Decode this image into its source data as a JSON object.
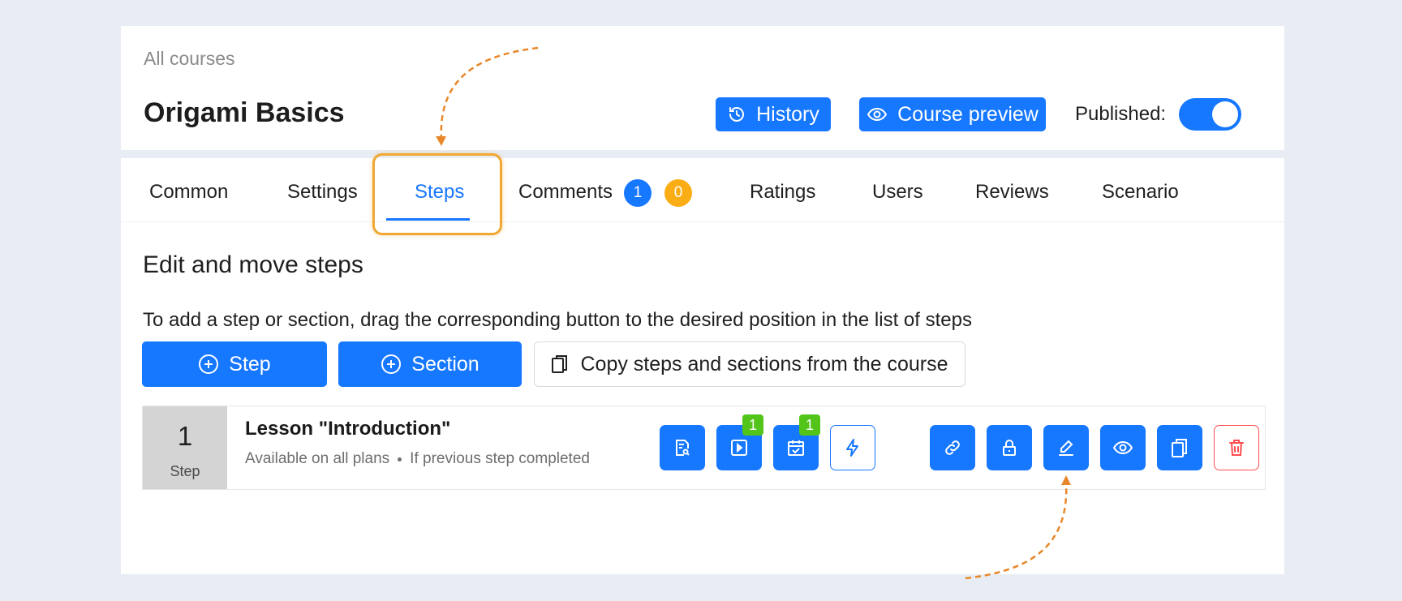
{
  "header": {
    "breadcrumb": "All courses",
    "title": "Origami Basics",
    "history_label": "History",
    "preview_label": "Course preview",
    "published_label": "Published:"
  },
  "tabs": [
    {
      "label": "Common"
    },
    {
      "label": "Settings"
    },
    {
      "label": "Steps"
    },
    {
      "label": "Comments"
    },
    {
      "label": "Ratings"
    },
    {
      "label": "Users"
    },
    {
      "label": "Reviews"
    },
    {
      "label": "Scenario"
    }
  ],
  "comments_badges": {
    "blue": "1",
    "orange": "0"
  },
  "steps_page": {
    "heading": "Edit and move steps",
    "instructions": "To add a step or section, drag the corresponding button to the desired position in the list of steps",
    "add_step_label": "Step",
    "add_section_label": "Section",
    "copy_label": "Copy steps and sections from the course"
  },
  "step": {
    "number": "1",
    "type_label": "Step",
    "title": "Lesson \"Introduction\"",
    "availability": "Available on all plans",
    "condition": "If previous step completed",
    "video_count": "1",
    "task_count": "1"
  },
  "colors": {
    "primary": "#1677ff",
    "highlight": "#f0a733",
    "success": "#52c41a",
    "warning": "#faad14",
    "danger": "#ff4d4f"
  }
}
